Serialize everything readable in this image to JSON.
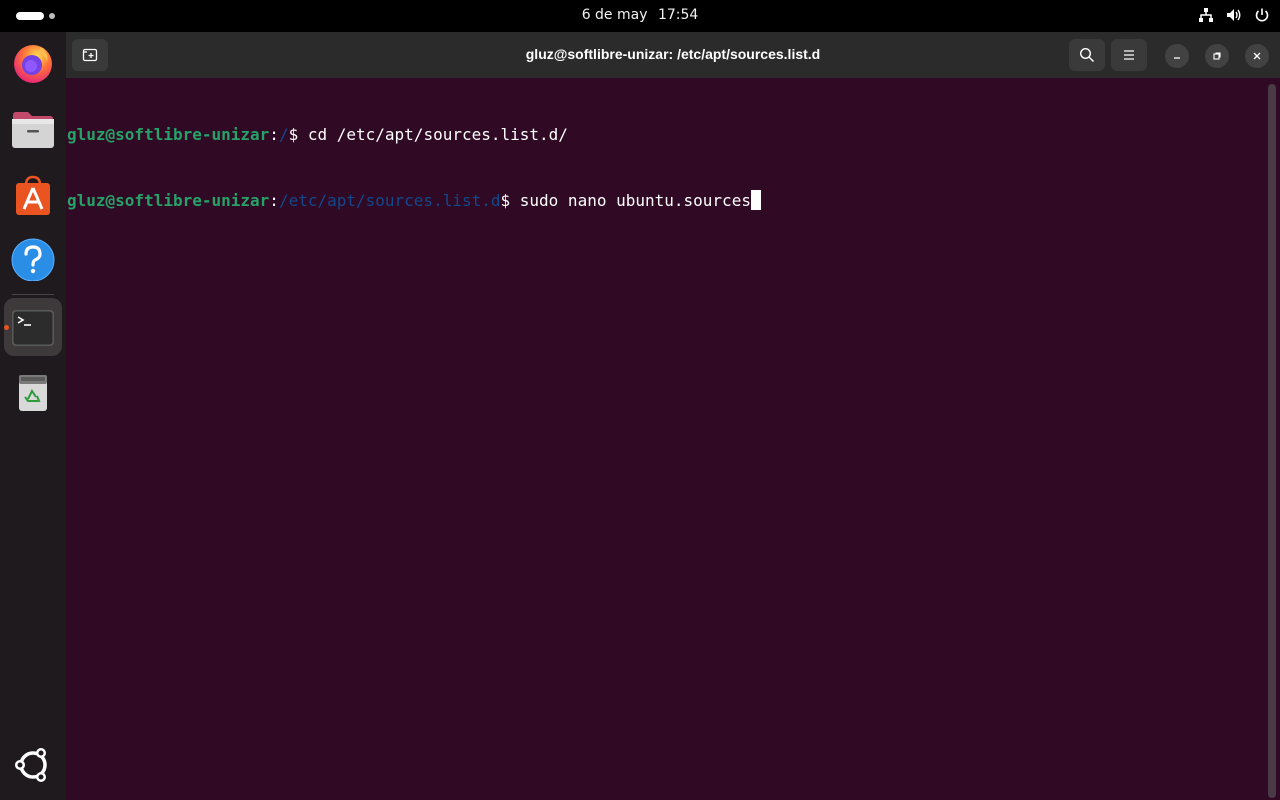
{
  "topbar": {
    "date": "6 de may",
    "time": "17:54",
    "tray_icons": [
      "network-icon",
      "volume-icon",
      "power-icon"
    ]
  },
  "dock": {
    "apps": [
      {
        "name": "firefox",
        "icon": "firefox-icon",
        "running": false
      },
      {
        "name": "files",
        "icon": "files-icon",
        "running": false
      },
      {
        "name": "app-center",
        "icon": "app-center-icon",
        "running": false
      },
      {
        "name": "help",
        "icon": "help-icon",
        "running": false
      },
      {
        "name": "terminal",
        "icon": "terminal-icon",
        "running": true
      },
      {
        "name": "trash",
        "icon": "trash-icon",
        "running": false
      }
    ],
    "show_apps_icon": "ubuntu-logo-icon"
  },
  "terminal": {
    "title": "gluz@softlibre-unizar: /etc/apt/sources.list.d",
    "lines": [
      {
        "user": "gluz@softlibre-unizar",
        "sep": ":",
        "path": "/",
        "prompt": "$ ",
        "command": "cd /etc/apt/sources.list.d/"
      },
      {
        "user": "gluz@softlibre-unizar",
        "sep": ":",
        "path": "/etc/apt/sources.list.d",
        "prompt": "$ ",
        "command": "sudo nano ubuntu.sources"
      }
    ],
    "colors": {
      "background": "#300a24",
      "user": "#26a269",
      "path": "#12488b",
      "text": "#ffffff"
    }
  }
}
